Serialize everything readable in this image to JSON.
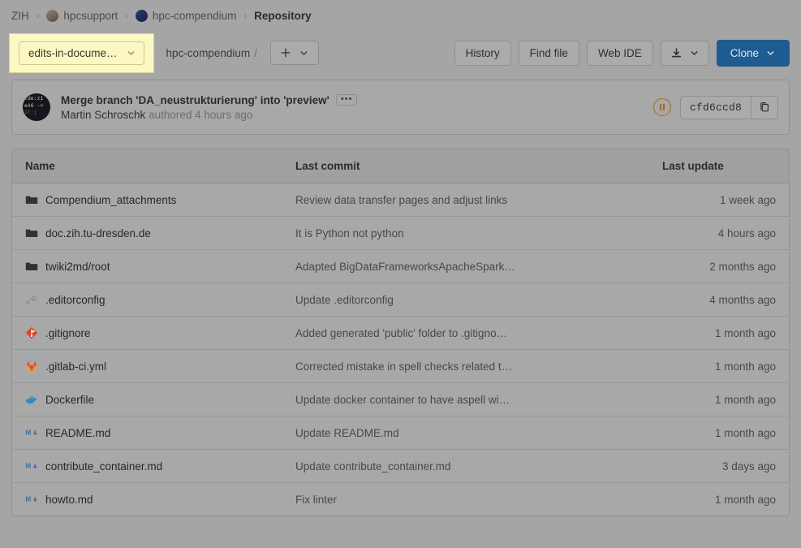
{
  "breadcrumb": {
    "items": [
      {
        "label": "ZIH",
        "avatar": null
      },
      {
        "label": "hpcsupport",
        "avatar": "group-avatar"
      },
      {
        "label": "hpc-compendium",
        "avatar": "project-avatar"
      },
      {
        "label": "Repository",
        "avatar": null
      }
    ],
    "separator": "›"
  },
  "toolbar": {
    "branch_label": "edits-in-docume…",
    "branch_highlighted": true,
    "highlight_color": "#fbf8c4",
    "path_root": "hpc-compendium",
    "path_separator": "/",
    "add_label": "+",
    "history_label": "History",
    "find_file_label": "Find file",
    "web_ide_label": "Web IDE",
    "download_label": "",
    "clone_label": "Clone",
    "clone_color": "#1f5b91"
  },
  "commit": {
    "title": "Merge branch 'DA_neustrukturierung' into 'preview'",
    "more_label": "•••",
    "author": "Martin Schroschk",
    "meta": "authored 4 hours ago",
    "status": "pending",
    "status_color": "#9d6b1e",
    "sha": "cfd6ccd8"
  },
  "files": {
    "headers": {
      "name": "Name",
      "last_commit": "Last commit",
      "last_update": "Last update"
    },
    "rows": [
      {
        "icon": "folder-icon",
        "name": "Compendium_attachments",
        "commit": "Review data transfer pages and adjust links",
        "update": "1 week ago"
      },
      {
        "icon": "folder-icon",
        "name": "doc.zih.tu-dresden.de",
        "commit": "It is Python not python",
        "update": "4 hours ago"
      },
      {
        "icon": "folder-icon",
        "name": "twiki2md/root",
        "commit": "Adapted BigDataFrameworksApacheSpark…",
        "update": "2 months ago"
      },
      {
        "icon": "editorconfig-icon",
        "name": ".editorconfig",
        "commit": "Update .editorconfig",
        "update": "4 months ago"
      },
      {
        "icon": "git-icon",
        "name": ".gitignore",
        "commit": "Added generated 'public' folder to .gitigno…",
        "update": "1 month ago"
      },
      {
        "icon": "gitlab-icon",
        "name": ".gitlab-ci.yml",
        "commit": "Corrected mistake in spell checks related t…",
        "update": "1 month ago"
      },
      {
        "icon": "docker-icon",
        "name": "Dockerfile",
        "commit": "Update docker container to have aspell wi…",
        "update": "1 month ago"
      },
      {
        "icon": "markdown-icon",
        "name": "README.md",
        "commit": "Update README.md",
        "update": "1 month ago"
      },
      {
        "icon": "markdown-icon",
        "name": "contribute_container.md",
        "commit": "Update contribute_container.md",
        "update": "3 days ago"
      },
      {
        "icon": "markdown-icon",
        "name": "howto.md",
        "commit": "Fix linter",
        "update": "1 month ago"
      }
    ]
  }
}
